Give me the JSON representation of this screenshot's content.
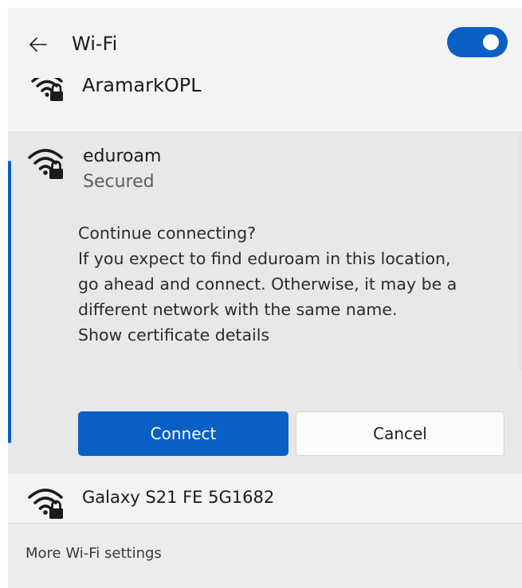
{
  "header": {
    "back_icon": "arrow-left-icon",
    "title": "Wi-Fi",
    "toggle_on": true,
    "accent_color": "#0a5fc5"
  },
  "networks": {
    "partial": {
      "label": "AramarkOPL",
      "icon": "wifi-secured-icon"
    },
    "selected": {
      "name": "eduroam",
      "status": "Secured",
      "icon": "wifi-secured-icon",
      "message_lines": [
        "Continue connecting?",
        "If you expect to find eduroam in this location,",
        "go ahead and connect. Otherwise, it may be a",
        "different network with the same name."
      ],
      "cert_link": "Show certificate details",
      "connect_label": "Connect",
      "cancel_label": "Cancel"
    },
    "other": {
      "name": "Galaxy S21 FE 5G1682",
      "icon": "wifi-secured-icon"
    }
  },
  "footer": {
    "link": "More Wi-Fi settings"
  }
}
